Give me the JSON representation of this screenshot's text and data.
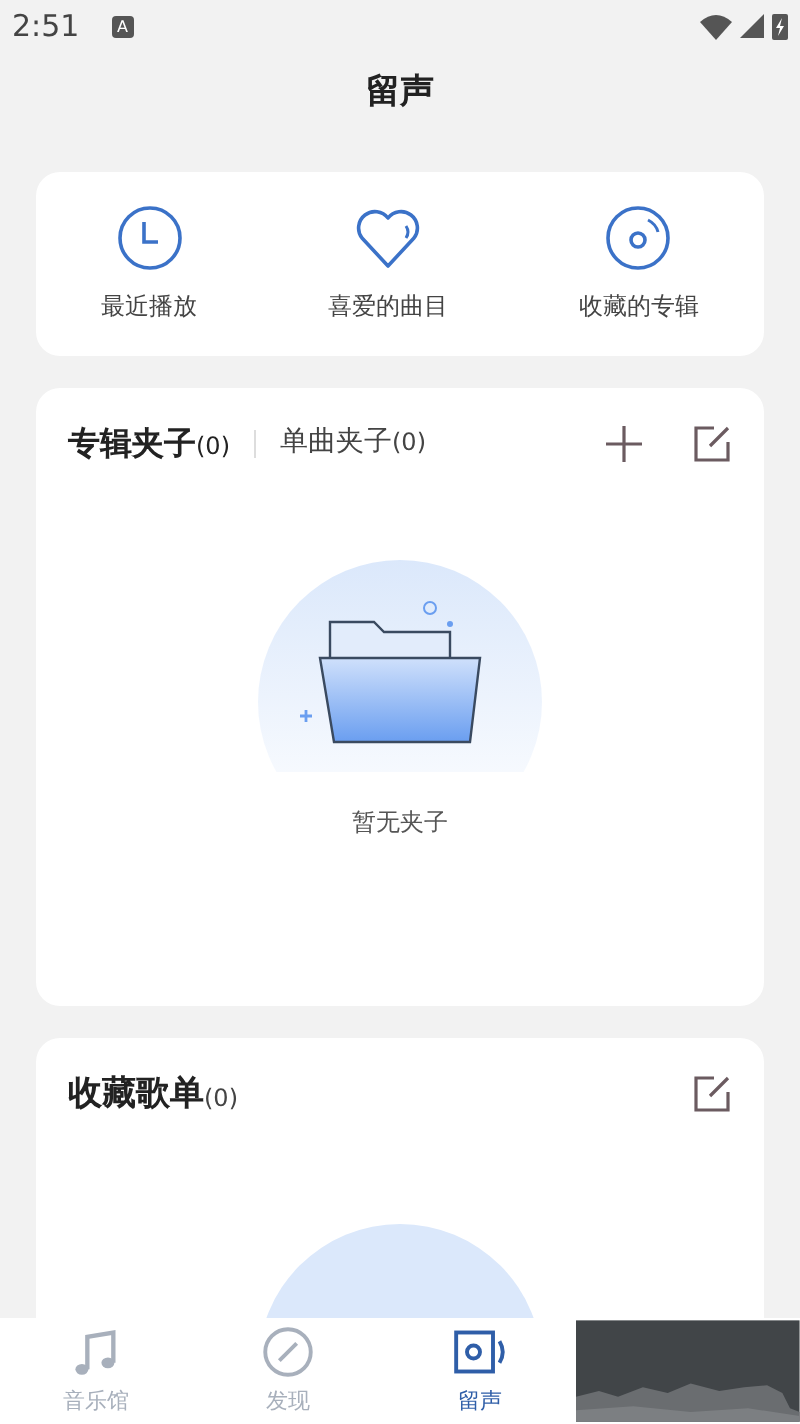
{
  "status_bar": {
    "time": "2:51",
    "notification": "A"
  },
  "header": {
    "title": "留声"
  },
  "shortcuts": [
    {
      "label": "最近播放",
      "kind": "clock"
    },
    {
      "label": "喜爱的曲目",
      "kind": "heart"
    },
    {
      "label": "收藏的专辑",
      "kind": "disc"
    }
  ],
  "folders": {
    "tabs": [
      {
        "label": "专辑夹子",
        "count": "(0)",
        "selected": true
      },
      {
        "label": "单曲夹子",
        "count": "(0)",
        "selected": false
      }
    ],
    "empty_text": "暂无夹子"
  },
  "playlists": {
    "title": "收藏歌单",
    "count": "(0)"
  },
  "bottom_nav": [
    {
      "label": "音乐馆",
      "kind": "music",
      "selected": false
    },
    {
      "label": "发现",
      "kind": "compass",
      "selected": false
    },
    {
      "label": "留声",
      "kind": "radio",
      "selected": true
    }
  ]
}
